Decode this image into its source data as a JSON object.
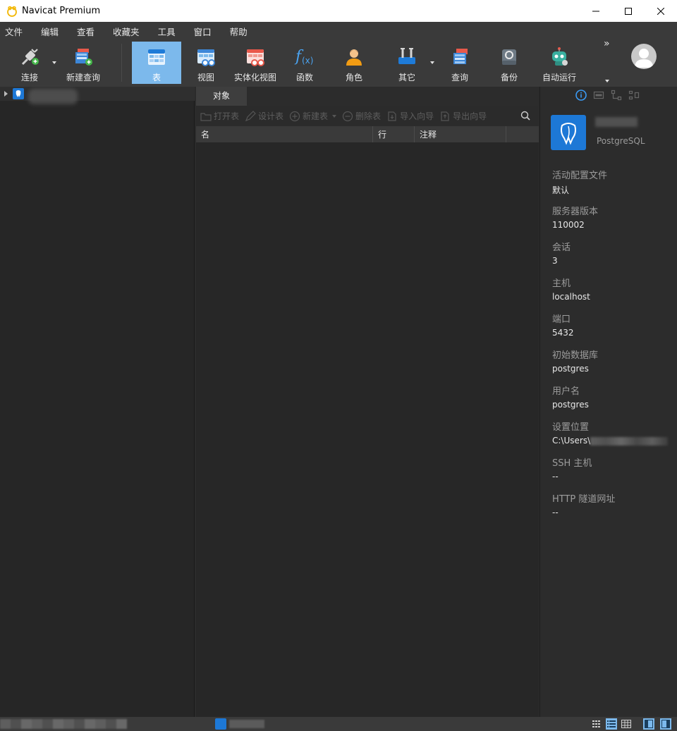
{
  "window": {
    "title": "Navicat Premium"
  },
  "menu": [
    "文件",
    "编辑",
    "查看",
    "收藏夹",
    "工具",
    "窗口",
    "帮助"
  ],
  "toolbar": {
    "connect": "连接",
    "new_query": "新建查询",
    "table": "表",
    "view": "视图",
    "mview": "实体化视图",
    "function": "函数",
    "role": "角色",
    "other": "其它",
    "query": "查询",
    "backup": "备份",
    "automation": "自动运行",
    "more": "»"
  },
  "object_tab": {
    "label": "对象"
  },
  "object_toolbar": {
    "open_table": "打开表",
    "design_table": "设计表",
    "new_table": "新建表",
    "delete_table": "删除表",
    "import_wizard": "导入向导",
    "export_wizard": "导出向导"
  },
  "grid": {
    "columns": [
      "名",
      "行",
      "注释"
    ]
  },
  "info_panel": {
    "db_type": "PostgreSQL",
    "properties": [
      {
        "label": "活动配置文件",
        "value": "默认"
      },
      {
        "label": "服务器版本",
        "value": "110002"
      },
      {
        "label": "会话",
        "value": "3"
      },
      {
        "label": "主机",
        "value": "localhost"
      },
      {
        "label": "端口",
        "value": "5432"
      },
      {
        "label": "初始数据库",
        "value": "postgres"
      },
      {
        "label": "用户名",
        "value": "postgres"
      },
      {
        "label": "设置位置",
        "value": "C:\\Users\\"
      },
      {
        "label": "SSH 主机",
        "value": "--"
      },
      {
        "label": "HTTP 隧道网址",
        "value": "--"
      }
    ]
  },
  "colors": {
    "accent": "#7cb9ec",
    "postgres_blue": "#1d78d6",
    "background": "#2b2b2b"
  }
}
